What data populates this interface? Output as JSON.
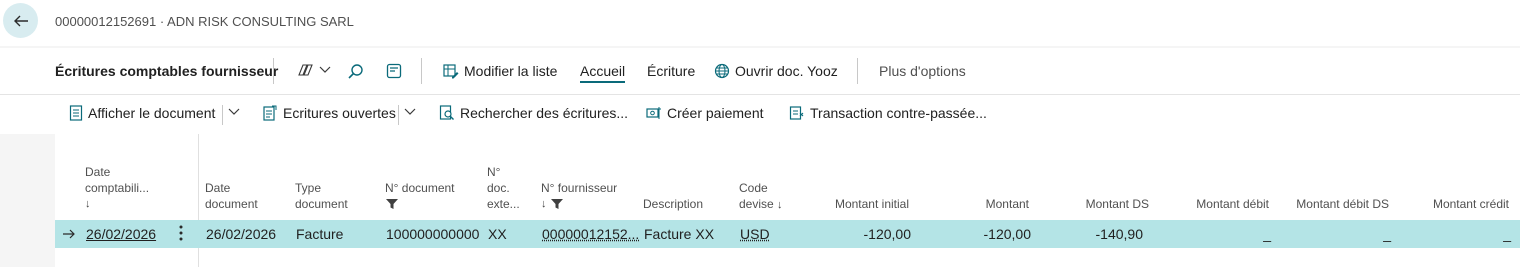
{
  "header": {
    "title": "00000012152691 · ADN RISK CONSULTING SARL"
  },
  "actionbar": {
    "page_title": "Écritures comptables fournisseur",
    "modify_list": "Modifier la liste",
    "tab_home": "Accueil",
    "tab_entry": "Écriture",
    "open_yooz": "Ouvrir doc. Yooz",
    "more_options": "Plus d'options"
  },
  "subbar": {
    "show_document": "Afficher le document",
    "open_entries": "Ecritures ouvertes",
    "find_entries": "Rechercher des écritures...",
    "create_payment": "Créer paiement",
    "reverse_transaction": "Transaction contre-passée..."
  },
  "columns": {
    "posting_date_1": "Date",
    "posting_date_2": "comptabili...",
    "doc_date_1": "Date",
    "doc_date_2": "document",
    "doc_type_1": "Type",
    "doc_type_2": "document",
    "doc_no": "N° document",
    "ext_doc_1": "N°",
    "ext_doc_2": "doc.",
    "ext_doc_3": "exte...",
    "vendor_no": "N° fournisseur",
    "description": "Description",
    "currency_1": "Code",
    "currency_2": "devise",
    "original_amount": "Montant initial",
    "amount": "Montant",
    "amount_lcy": "Montant DS",
    "debit_amount": "Montant débit",
    "debit_amount_lcy": "Montant débit DS",
    "credit_amount": "Montant crédit"
  },
  "rows": [
    {
      "posting_date": "26/02/2026",
      "document_date": "26/02/2026",
      "document_type": "Facture",
      "document_no": "100000000000",
      "external_doc_no": "XX",
      "vendor_no": "00000012152...",
      "description": "Facture XX",
      "currency_code": "USD",
      "original_amount": "-120,00",
      "amount": "-120,00",
      "amount_lcy": "-140,90",
      "debit_amount": "_",
      "debit_amount_lcy": "_",
      "credit_amount": "_"
    }
  ],
  "colors": {
    "accent": "#0a6a7a",
    "row_selected": "#b4e4e6",
    "back_button": "#d8ecf0"
  }
}
